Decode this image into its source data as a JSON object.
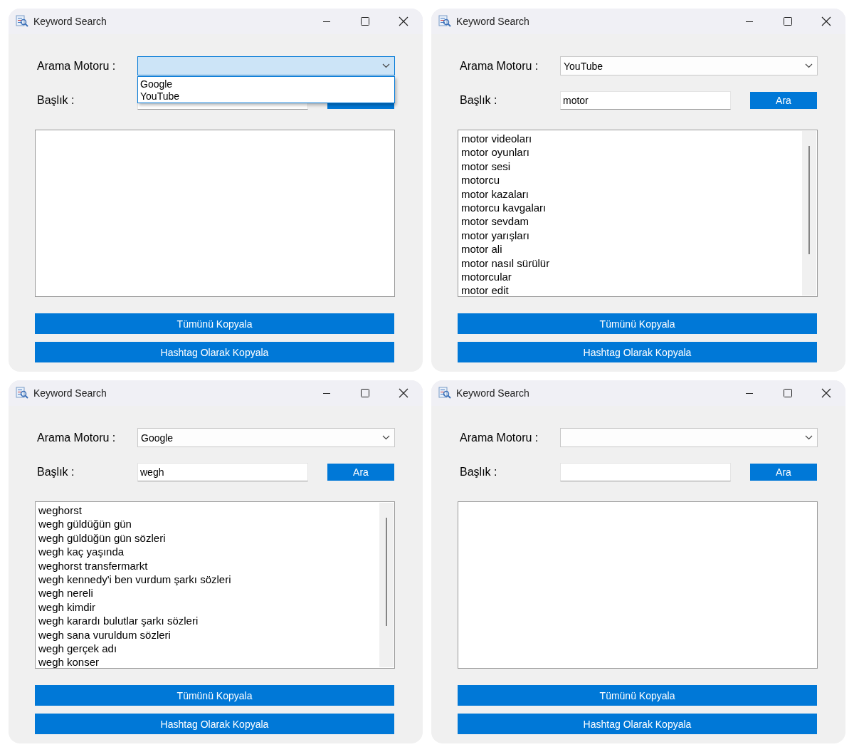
{
  "windows": [
    {
      "title": "Keyword Search",
      "engine_label": "Arama Motoru :",
      "engine": {
        "focused": true,
        "open": true,
        "options": [
          {
            "label": "Google",
            "selected": false
          },
          {
            "label": "YouTube",
            "selected": false
          }
        ]
      },
      "title_label": "Başlık :",
      "copy_all": "Tümünü Kopyala",
      "copy_hashtag": "Hashtag Olarak Kopyala"
    },
    {
      "title": "Keyword Search",
      "engine_label": "Arama Motoru :",
      "engine": {
        "value": "YouTube",
        "focused": false,
        "open": false
      },
      "title_label": "Başlık :",
      "title_value": "motor",
      "search_button": "Ara",
      "copy_all": "Tümünü Kopyala",
      "copy_hashtag": "Hashtag Olarak Kopyala",
      "results": [
        "motor videoları",
        "motor oyunları",
        "motor sesi",
        "motorcu",
        "motor kazaları",
        "motorcu kavgaları",
        "motor sevdam",
        "motor yarışları",
        "motor ali",
        "motor nasıl sürülür",
        "motorcular",
        "motor edit"
      ]
    },
    {
      "title": "Keyword Search",
      "engine_label": "Arama Motoru :",
      "engine": {
        "value": "Google",
        "focused": false,
        "open": false
      },
      "title_label": "Başlık :",
      "title_value": "wegh",
      "search_button": "Ara",
      "copy_all": "Tümünü Kopyala",
      "copy_hashtag": "Hashtag Olarak Kopyala",
      "results": [
        "weghorst",
        "wegh güldüğün gün",
        "wegh güldüğün gün sözleri",
        "wegh kaç yaşında",
        "weghorst transfermarkt",
        "wegh kennedy'i ben vurdum şarkı sözleri",
        "wegh nereli",
        "wegh kimdir",
        "wegh karardı bulutlar şarkı sözleri",
        "wegh sana vuruldum sözleri",
        "wegh gerçek adı",
        "wegh konser"
      ]
    },
    {
      "title": "Keyword Search",
      "engine_label": "Arama Motoru :",
      "engine": {
        "focused": false,
        "open": false
      },
      "title_label": "Başlık :",
      "search_button": "Ara",
      "copy_all": "Tümünü Kopyala",
      "copy_hashtag": "Hashtag Olarak Kopyala"
    }
  ]
}
